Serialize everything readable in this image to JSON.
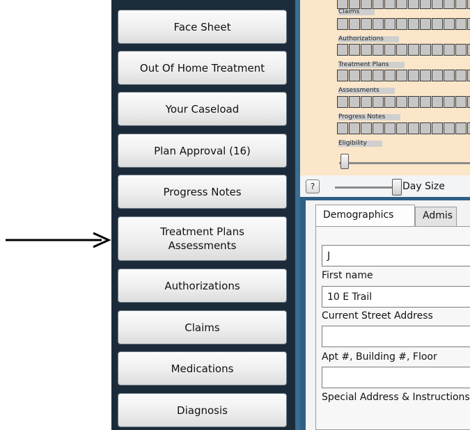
{
  "sidebar": {
    "items": [
      {
        "label": "Face Sheet"
      },
      {
        "label": "Out Of Home Treatment"
      },
      {
        "label": "Your Caseload"
      },
      {
        "label": "Plan Approval (16)"
      },
      {
        "label": "Progress Notes"
      },
      {
        "label_line1": "Treatment Plans",
        "label_line2": "Assessments"
      },
      {
        "label": "Authorizations"
      },
      {
        "label": "Claims"
      },
      {
        "label": "Medications"
      },
      {
        "label": "Diagnosis"
      }
    ]
  },
  "calendar": {
    "rows": [
      "Claims",
      "Authorizations",
      "Treatment Plans",
      "Assessments",
      "Progress Notes",
      "Eligibility"
    ]
  },
  "toolbar": {
    "help_label": "?",
    "day_size_label": "Day Size"
  },
  "form": {
    "tabs": [
      "Demographics",
      "Admis"
    ],
    "fields": [
      {
        "value": "J",
        "label": "First name"
      },
      {
        "value": "10 E Trail",
        "label": "Current Street Address"
      },
      {
        "value": "",
        "label": "Apt #, Building #, Floor"
      },
      {
        "value": "",
        "label": "Special Address & Instructions"
      }
    ]
  },
  "colors": {
    "sidebar_bg": "#1c2b3a",
    "calendar_bg": "#fbe6c9",
    "panel_border": "#2e5f86"
  }
}
